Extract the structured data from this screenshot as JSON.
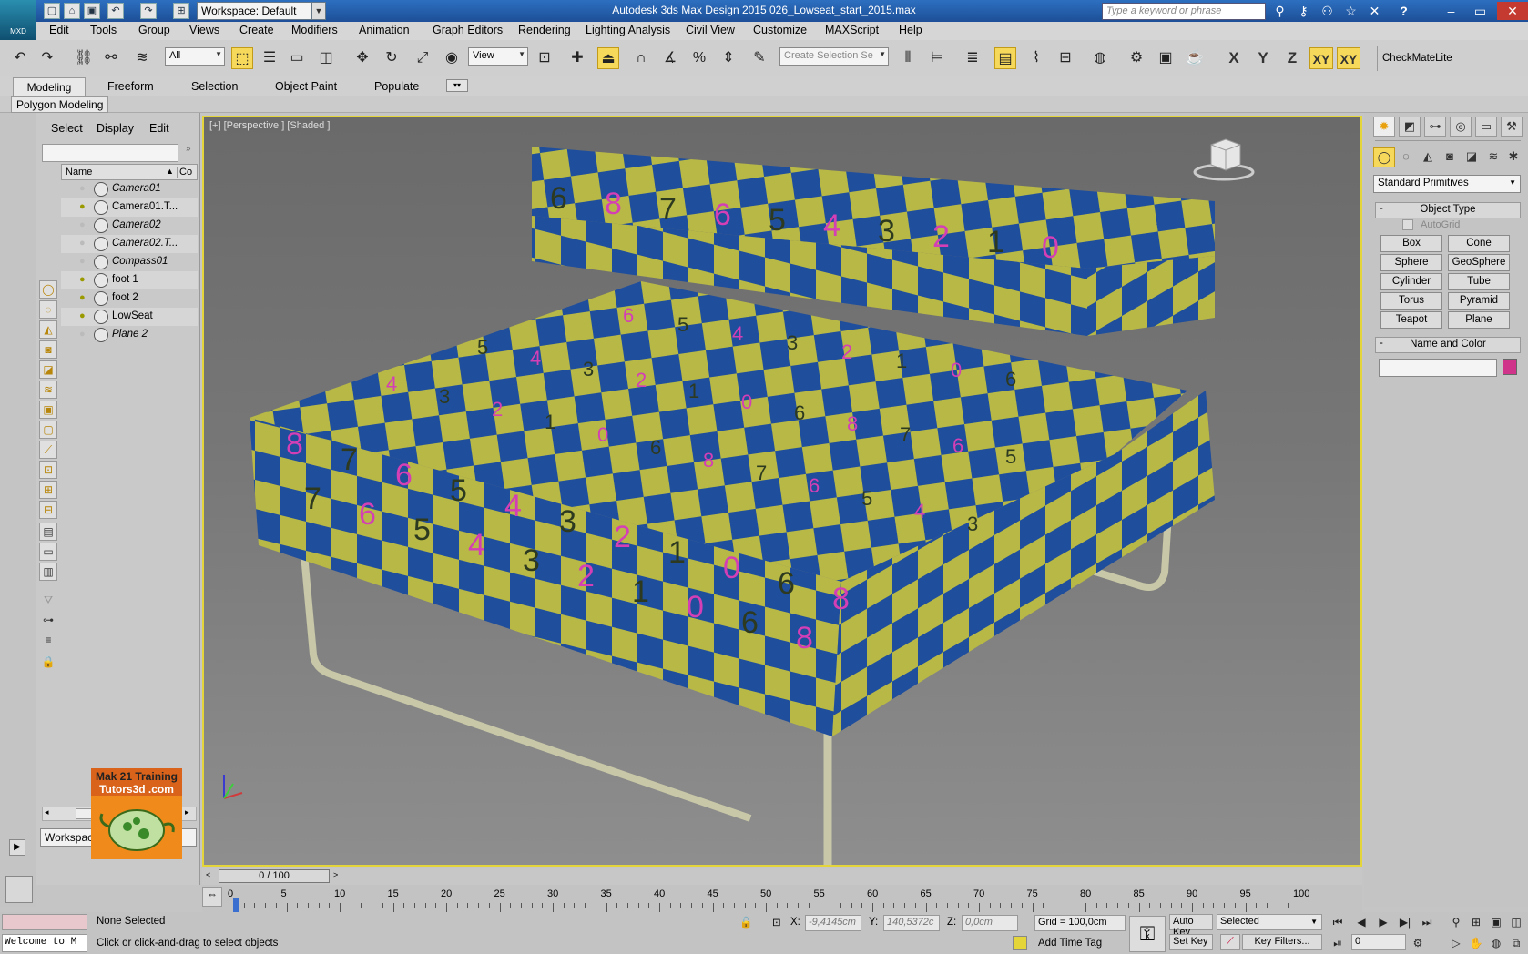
{
  "title_bar": {
    "app_title": "Autodesk 3ds Max Design 2015      026_Lowseat_start_2015.max",
    "logo_text": "MXD",
    "workspace": "Workspace: Default",
    "search_placeholder": "Type a keyword or phrase",
    "help_label": "?"
  },
  "menu": [
    "Edit",
    "Tools",
    "Group",
    "Views",
    "Create",
    "Modifiers",
    "Animation",
    "Graph Editors",
    "Rendering",
    "Lighting Analysis",
    "Civil View",
    "Customize",
    "MAXScript",
    "Help"
  ],
  "toolbar": {
    "filter_value": "All",
    "ref_coord_value": "View",
    "selection_set_placeholder": "Create Selection Se",
    "axis_x": "X",
    "axis_y": "Y",
    "axis_z": "Z",
    "axis_xy": "XY",
    "axis_xy2": "XY",
    "checkmate": "CheckMateLite"
  },
  "ribbon": {
    "tabs": [
      "Modeling",
      "Freeform",
      "Selection",
      "Object Paint",
      "Populate"
    ],
    "panel_label": "Polygon Modeling"
  },
  "scene_explorer": {
    "tabs": [
      "Select",
      "Display",
      "Edit"
    ],
    "col_name": "Name",
    "col_short": "Co",
    "items": [
      {
        "name": "Camera01",
        "italic": true,
        "light": "off"
      },
      {
        "name": "Camera01.T...",
        "italic": false,
        "light": "on"
      },
      {
        "name": "Camera02",
        "italic": true,
        "light": "off"
      },
      {
        "name": "Camera02.T...",
        "italic": true,
        "light": "off"
      },
      {
        "name": "Compass01",
        "italic": true,
        "light": "off"
      },
      {
        "name": "foot 1",
        "italic": false,
        "light": "on"
      },
      {
        "name": "foot 2",
        "italic": false,
        "light": "on"
      },
      {
        "name": "LowSeat",
        "italic": false,
        "light": "on"
      },
      {
        "name": "Plane 2",
        "italic": true,
        "light": "off"
      }
    ],
    "workspace": "Workspace: Default"
  },
  "ad": {
    "line1": "Mak 21 Training",
    "line2": "Tutors3d .com"
  },
  "viewport": {
    "label_plus": "[+]",
    "label_view": "[Perspective ]",
    "label_shade": "[Shaded ]"
  },
  "command_panel": {
    "category": "Standard Primitives",
    "object_type": "Object Type",
    "autogrid": "AutoGrid",
    "buttons": [
      "Box",
      "Cone",
      "Sphere",
      "GeoSphere",
      "Cylinder",
      "Tube",
      "Torus",
      "Pyramid",
      "Teapot",
      "Plane"
    ],
    "name_and_color": "Name and Color",
    "swatch_color": "#d0338a"
  },
  "time": {
    "slider": "0 / 100",
    "ticks": [
      "0",
      "5",
      "10",
      "15",
      "20",
      "25",
      "30",
      "35",
      "40",
      "45",
      "50",
      "55",
      "60",
      "65",
      "70",
      "75",
      "80",
      "85",
      "90",
      "95",
      "100"
    ]
  },
  "status": {
    "selection": "None Selected",
    "prompt": "Click or click-and-drag to select objects",
    "maxscript": "Welcome to M",
    "x_label": "X:",
    "x_value": "-9,4145cm",
    "y_label": "Y:",
    "y_value": "140,5372c",
    "z_label": "Z:",
    "z_value": "0,0cm",
    "grid": "Grid = 100,0cm",
    "add_time_tag": "Add Time Tag",
    "auto_key": "Auto Key",
    "set_key": "Set Key",
    "key_mode": "Selected",
    "key_filters": "Key Filters...",
    "frame": "0"
  },
  "checker_digits": [
    "6",
    "8",
    "7",
    "6",
    "5",
    "4",
    "3",
    "2",
    "1",
    "0"
  ],
  "checker_colors": {
    "blue": "#1f4e9c",
    "yellow": "#b7b845",
    "digit": "#d43fb6",
    "dark": "#2d3a20"
  }
}
